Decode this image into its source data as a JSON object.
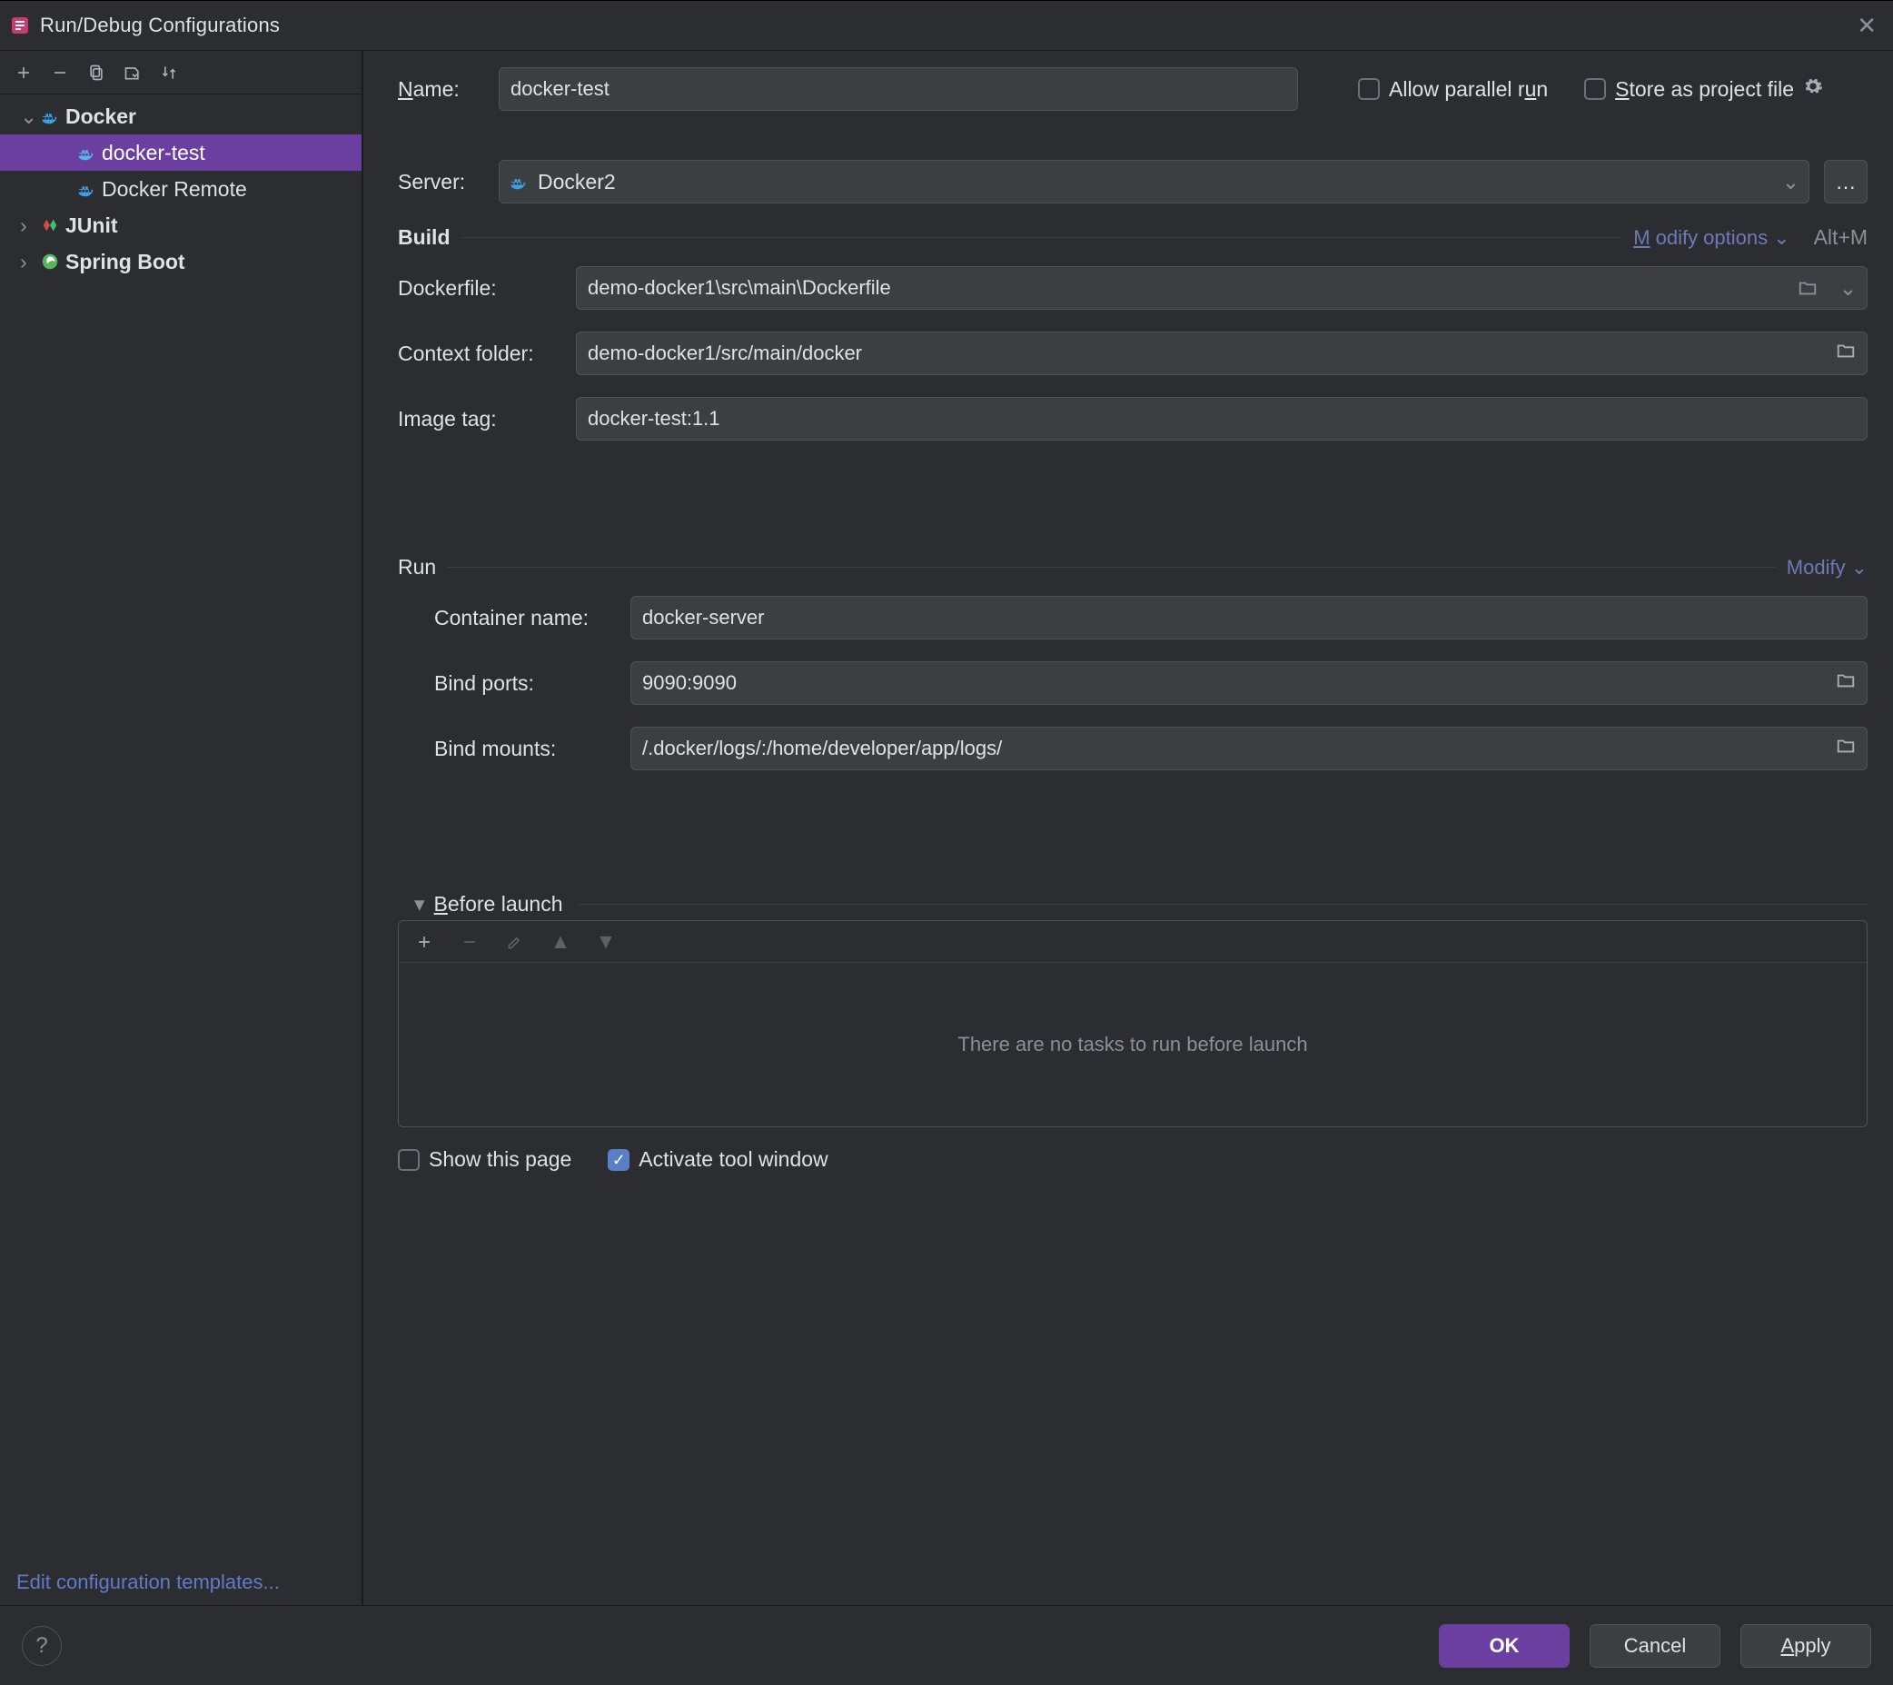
{
  "window": {
    "title": "Run/Debug Configurations"
  },
  "sidebar": {
    "edit_templates": "Edit configuration templates...",
    "items": [
      {
        "label": "Docker",
        "icon": "docker",
        "bold": true,
        "level": 1,
        "expanded": true
      },
      {
        "label": "docker-test",
        "icon": "docker",
        "level": 2,
        "selected": true
      },
      {
        "label": "Docker Remote",
        "icon": "docker",
        "level": 2
      },
      {
        "label": "JUnit",
        "icon": "junit",
        "bold": true,
        "level": 1,
        "expanded": false
      },
      {
        "label": "Spring Boot",
        "icon": "spring",
        "bold": true,
        "level": 1,
        "expanded": false
      }
    ]
  },
  "form": {
    "name_label": "Name:",
    "name_value": "docker-test",
    "allow_parallel_label": "Allow parallel run",
    "store_label": "Store as project file",
    "server_label": "Server:",
    "server_value": "Docker2",
    "build_title": "Build",
    "modify_options": "Modify options",
    "modify_shortcut": "Alt+M",
    "dockerfile_label": "Dockerfile:",
    "dockerfile_value": "demo-docker1\\src\\main\\Dockerfile",
    "context_label": "Context folder:",
    "context_value": "demo-docker1/src/main/docker",
    "image_tag_label": "Image tag:",
    "image_tag_value": "docker-test:1.1",
    "run_title": "Run",
    "modify": "Modify",
    "container_label": "Container name:",
    "container_value": "docker-server",
    "ports_label": "Bind ports:",
    "ports_value": "9090:9090",
    "mounts_label": "Bind mounts:",
    "mounts_value": "/.docker/logs/:/home/developer/app/logs/",
    "before_launch_title": "Before launch",
    "before_launch_empty": "There are no tasks to run before launch",
    "show_page_label": "Show this page",
    "activate_label": "Activate tool window"
  },
  "footer": {
    "ok": "OK",
    "cancel": "Cancel",
    "apply": "Apply"
  }
}
